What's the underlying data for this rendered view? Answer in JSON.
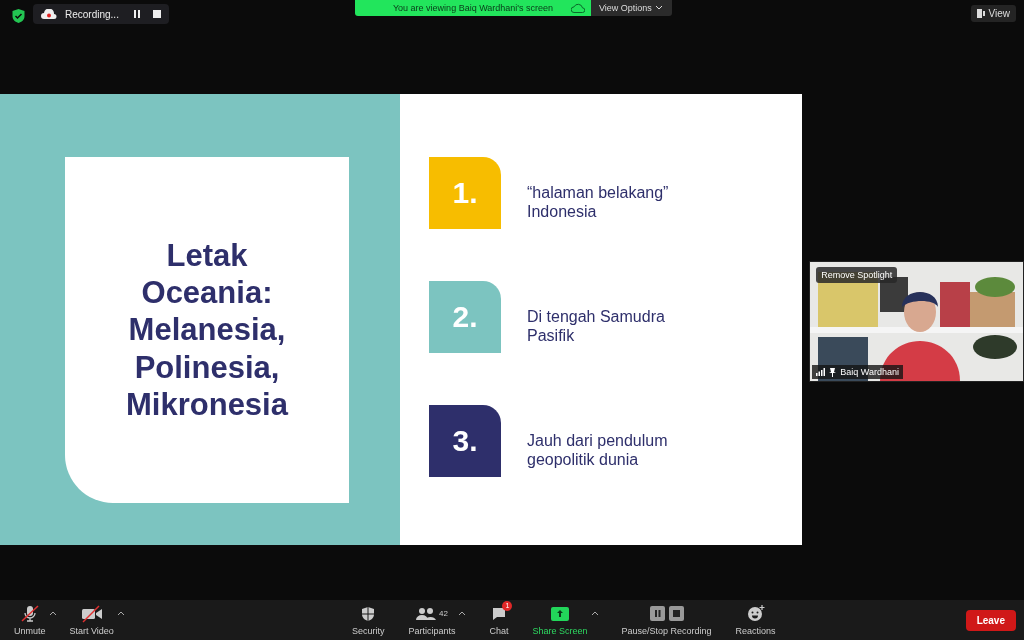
{
  "top_bar": {
    "recording": {
      "label": "Recording..."
    },
    "banner": {
      "text": "You are viewing Baiq Wardhani's screen",
      "options": "View Options"
    },
    "view_button": "View"
  },
  "slide": {
    "title": "Letak Oceania: Melanesia, Polinesia, Mikronesia",
    "points": [
      {
        "number": "1.",
        "text": "“halaman belakang” Indonesia",
        "color": "#f7bd00"
      },
      {
        "number": "2.",
        "text": "Di tengah Samudra Pasifik",
        "color": "#7cc4c0"
      },
      {
        "number": "3.",
        "text": "Jauh dari pendulum geopolitik dunia",
        "color": "#2e2f6b"
      }
    ]
  },
  "video_tile": {
    "spotlight": "Remove Spotlight",
    "name": "Baiq Wardhani"
  },
  "toolbar": {
    "left": [
      {
        "kind": "mic",
        "label": "Unmute",
        "off": true
      },
      {
        "kind": "video",
        "label": "Start Video",
        "off": true
      }
    ],
    "center": [
      {
        "kind": "security",
        "label": "Security"
      },
      {
        "kind": "participants",
        "label": "Participants",
        "count": "42"
      },
      {
        "kind": "chat",
        "label": "Chat",
        "badge": "1"
      },
      {
        "kind": "share",
        "label": "Share Screen"
      },
      {
        "kind": "recording",
        "label": "Pause/Stop Recording"
      },
      {
        "kind": "reactions",
        "label": "Reactions"
      }
    ],
    "leave": "Leave"
  }
}
